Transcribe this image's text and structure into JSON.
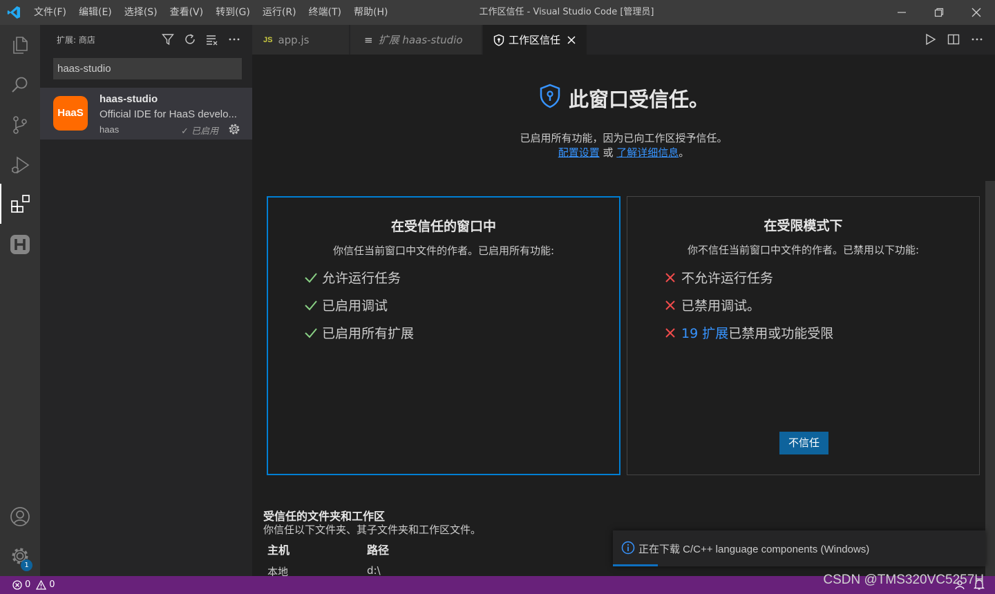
{
  "window": {
    "title": "工作区信任 - Visual Studio Code [管理员]",
    "menu": [
      "文件(F)",
      "编辑(E)",
      "选择(S)",
      "查看(V)",
      "转到(G)",
      "运行(R)",
      "终端(T)",
      "帮助(H)"
    ]
  },
  "activity": {
    "icons": [
      "explorer-icon",
      "search-icon",
      "source-control-icon",
      "run-debug-icon",
      "extensions-icon",
      "haas-icon",
      "account-icon",
      "manage-gear-icon"
    ],
    "manage_badge": "1"
  },
  "sidebar": {
    "title": "扩展: 商店",
    "search_value": "haas-studio",
    "extension": {
      "logo_text": "HaaS",
      "name": "haas-studio",
      "description": "Official IDE for HaaS develo...",
      "publisher": "haas",
      "status": "✓ 已启用"
    }
  },
  "tabs": [
    {
      "icon": "JS",
      "label": "app.js"
    },
    {
      "icon": "≡",
      "label": "扩展 haas-studio"
    },
    {
      "label": "工作区信任"
    }
  ],
  "trust": {
    "title": "此窗口受信任。",
    "subtitle": "已启用所有功能，因为已向工作区授予信任。",
    "link1": "配置设置",
    "or_text": " 或 ",
    "link2": "了解详细信息",
    "end": "。",
    "trusted_card": {
      "title": "在受信任的窗口中",
      "subtitle": "你信任当前窗口中文件的作者。已启用所有功能:",
      "features": [
        "允许运行任务",
        "已启用调试",
        "已启用所有扩展"
      ]
    },
    "restricted_card": {
      "title": "在受限模式下",
      "subtitle": "你不信任当前窗口中文件的作者。已禁用以下功能:",
      "features": [
        "不允许运行任务",
        "已禁用调试。"
      ],
      "ext_link": "19 扩展",
      "ext_rest": "已禁用或功能受限",
      "button": "不信任"
    },
    "folders": {
      "title": "受信任的文件夹和工作区",
      "subtitle": "你信任以下文件夹、其子文件夹和工作区文件。",
      "col_host": "主机",
      "col_path": "路径",
      "row_host": "本地",
      "row_path": "d:\\"
    }
  },
  "notification": {
    "message": "正在下载 C/C++ language components (Windows)"
  },
  "status": {
    "errors": "0",
    "warnings": "0",
    "watermark": "CSDN @TMS320VC5257H"
  },
  "colors": {
    "accent": "#007fd4",
    "statusbar": "#68217a",
    "check": "#89d185",
    "cross": "#f14c4c",
    "link": "#3794ff"
  }
}
